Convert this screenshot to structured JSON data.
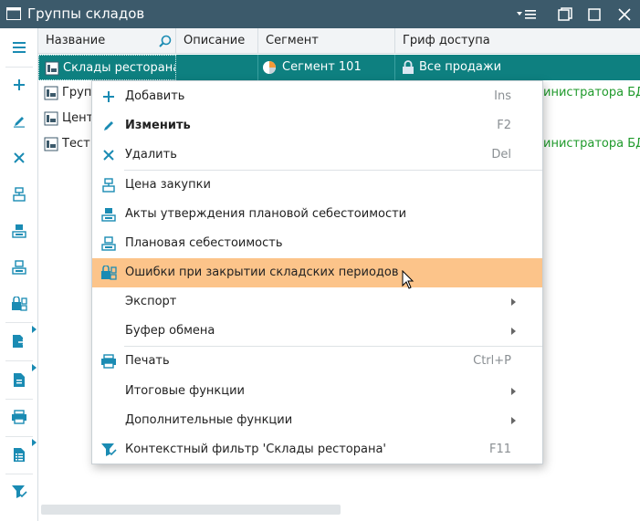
{
  "window": {
    "title": "Группы складов",
    "controls": [
      "menu-icon",
      "restore-icon",
      "maximize-icon",
      "close-icon"
    ]
  },
  "toolbar": {
    "buttons": [
      {
        "name": "hamburger-menu-icon",
        "color": "#1a8bb3"
      },
      {
        "name": "add-icon",
        "color": "#1a8bb3"
      },
      {
        "name": "edit-icon",
        "color": "#1a8bb3"
      },
      {
        "name": "delete-icon",
        "color": "#1a8bb3"
      },
      {
        "name": "purchase-price-icon",
        "color": "#1a8bb3"
      },
      {
        "name": "approval-acts-icon",
        "color": "#1a8bb3"
      },
      {
        "name": "planned-cost-icon",
        "color": "#1a8bb3"
      },
      {
        "name": "period-errors-icon",
        "color": "#1a8bb3"
      },
      {
        "name": "export-icon",
        "color": "#1a8bb3"
      },
      {
        "name": "clipboard-icon",
        "color": "#1a8bb3"
      },
      {
        "name": "print-icon",
        "color": "#1a8bb3"
      },
      {
        "name": "functions-icon",
        "color": "#1a8bb3"
      },
      {
        "name": "filter-icon",
        "color": "#1a8bb3"
      }
    ]
  },
  "grid": {
    "columns": [
      "Название",
      "Описание",
      "Сегмент",
      "Гриф доступа"
    ],
    "rows": [
      {
        "name": "Склады ресторана",
        "description": "",
        "segment": "Сегмент 101",
        "access": "Все продажи",
        "selected": true
      },
      {
        "name": "Груп",
        "description": "",
        "segment": "",
        "access": "инистратора БД",
        "selected": false
      },
      {
        "name": "Цент",
        "description": "",
        "segment": "",
        "access": "",
        "selected": false
      },
      {
        "name": "Тест",
        "description": "",
        "segment": "",
        "access": "инистратора БД",
        "selected": false
      }
    ]
  },
  "menu": {
    "items": [
      {
        "label": "Добавить",
        "shortcut": "Ins",
        "icon": "add-icon",
        "bold": false
      },
      {
        "label": "Изменить",
        "shortcut": "F2",
        "icon": "edit-icon",
        "bold": true
      },
      {
        "label": "Удалить",
        "shortcut": "Del",
        "icon": "delete-icon",
        "bold": false
      },
      {
        "label": "Цена закупки",
        "shortcut": "",
        "icon": "purchase-price-icon",
        "bold": false
      },
      {
        "label": "Акты утверждения плановой себестоимости",
        "shortcut": "",
        "icon": "approval-acts-icon",
        "bold": false
      },
      {
        "label": "Плановая себестоимость",
        "shortcut": "",
        "icon": "planned-cost-icon",
        "bold": false
      },
      {
        "label": "Ошибки при закрытии складских периодов",
        "shortcut": "",
        "icon": "period-errors-icon",
        "bold": false,
        "highlighted": true
      },
      {
        "label": "Экспорт",
        "shortcut": "",
        "icon": "",
        "submenu": true
      },
      {
        "label": "Буфер обмена",
        "shortcut": "",
        "icon": "",
        "submenu": true
      },
      {
        "label": "Печать",
        "shortcut": "Ctrl+P",
        "icon": "print-icon",
        "bold": false
      },
      {
        "label": "Итоговые функции",
        "shortcut": "",
        "icon": "",
        "submenu": true
      },
      {
        "label": "Дополнительные функции",
        "shortcut": "",
        "icon": "",
        "submenu": true
      },
      {
        "label": "Контекстный фильтр 'Склады ресторана'",
        "shortcut": "F11",
        "icon": "filter-icon",
        "bold": false
      }
    ]
  },
  "colors": {
    "titlebar": "#3c5a6b",
    "accent": "#1a8bb3",
    "selected_row": "#0e8080",
    "highlight": "#fcc48a",
    "access_text": "#1f9a2b"
  }
}
